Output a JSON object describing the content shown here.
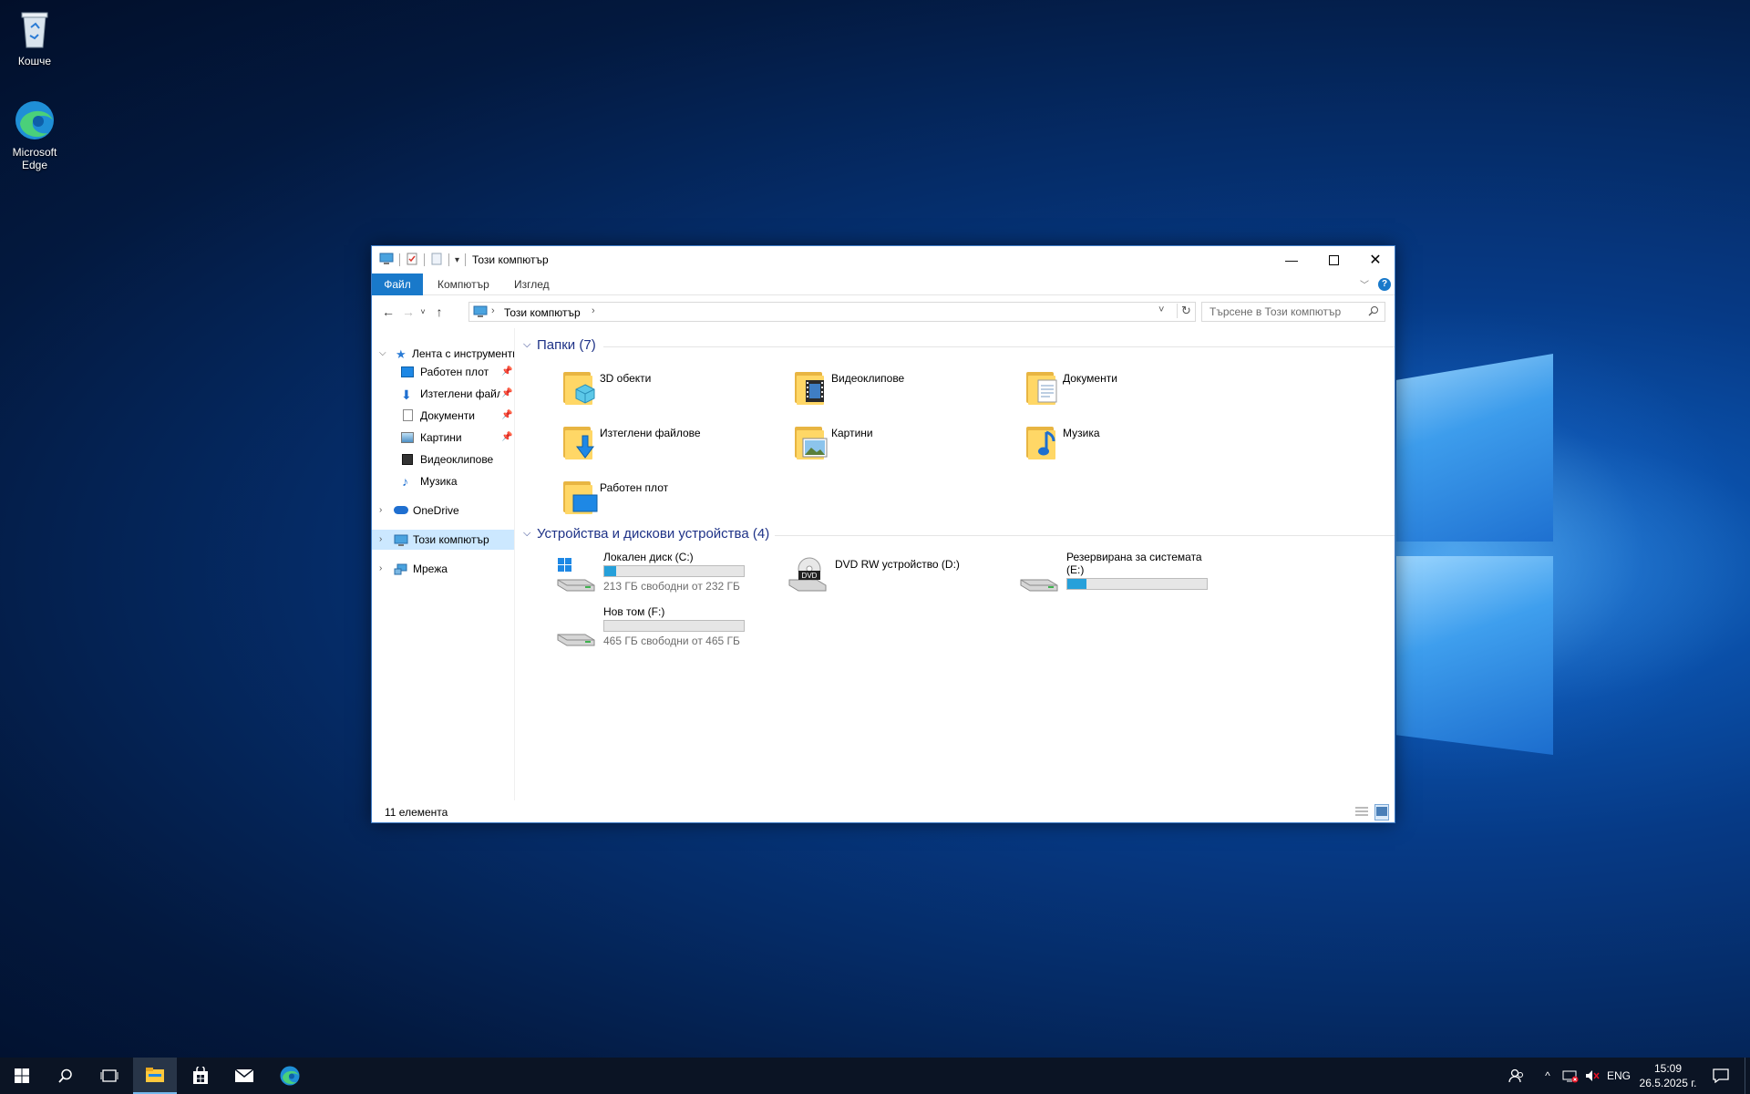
{
  "desktop": {
    "icons": [
      {
        "label": "Кошче",
        "icon": "recycle-bin-icon"
      },
      {
        "label": "Microsoft Edge",
        "icon": "edge-icon"
      }
    ]
  },
  "window": {
    "title": "Този компютър",
    "ribbon_tabs": [
      "Файл",
      "Компютър",
      "Изглед"
    ],
    "address": {
      "crumb": "Този компютър"
    },
    "search": {
      "placeholder": "Търсене в Този компютър"
    },
    "nav": {
      "quick_access": "Лента с инструменти",
      "quick_items": [
        {
          "label": "Работен плот",
          "pinned": true
        },
        {
          "label": "Изтеглени файлове",
          "pinned": true
        },
        {
          "label": "Документи",
          "pinned": true
        },
        {
          "label": "Картини",
          "pinned": true
        },
        {
          "label": "Видеоклипове",
          "pinned": false
        },
        {
          "label": "Музика",
          "pinned": false
        }
      ],
      "onedrive": "OneDrive",
      "this_pc": "Този компютър",
      "network": "Мрежа"
    },
    "folders_header": "Папки (7)",
    "folders": [
      {
        "label": "3D обекти"
      },
      {
        "label": "Видеоклипове"
      },
      {
        "label": "Документи"
      },
      {
        "label": "Изтеглени файлове"
      },
      {
        "label": "Картини"
      },
      {
        "label": "Музика"
      },
      {
        "label": "Работен плот"
      }
    ],
    "devices_header": "Устройства и дискови устройства (4)",
    "drives": [
      {
        "label": "Локален диск (C:)",
        "free": "213 ГБ свободни от 232 ГБ",
        "used_fraction": 0.082
      },
      {
        "label": "DVD RW устройство (D:)",
        "free": "",
        "used_fraction": null
      },
      {
        "label": "Резервирана за системата (E:)",
        "free": "",
        "used_fraction": 0.14
      },
      {
        "label": "Нов том (F:)",
        "free": "465 ГБ свободни от 465 ГБ",
        "used_fraction": 0.0
      }
    ],
    "status": "11 елемента"
  },
  "taskbar": {
    "tray_lang": "ENG",
    "time": "15:09",
    "date": "26.5.2025 г."
  },
  "colors": {
    "accent": "#1979ca",
    "progress": "#26a0da",
    "selection": "#cce8ff",
    "group_header": "#1e3287"
  }
}
